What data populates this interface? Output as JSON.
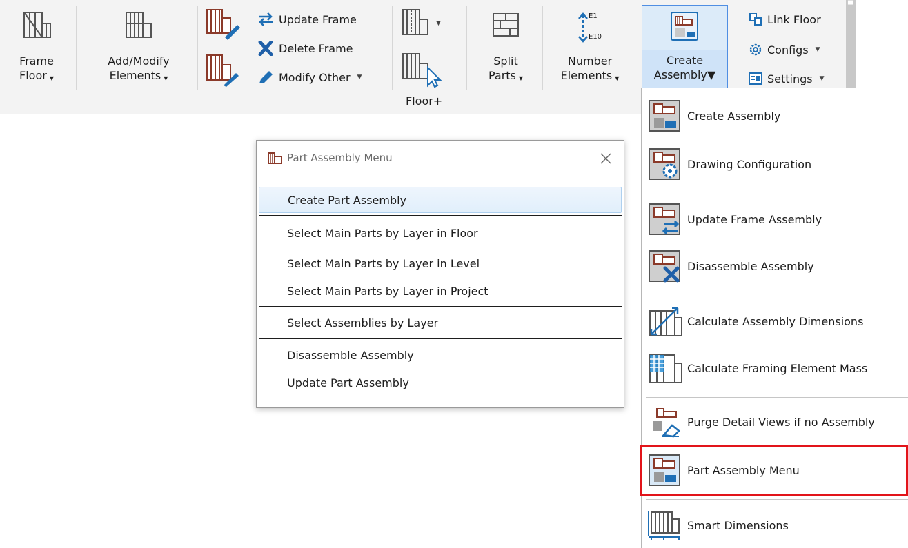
{
  "ribbon": {
    "frame_floor": [
      "Frame",
      "Floor"
    ],
    "add_modify": [
      "Add/Modify",
      "Elements"
    ],
    "update_frame": "Update Frame",
    "delete_frame": "Delete Frame",
    "modify_other": "Modify Other",
    "floor_plus_group": "Floor+",
    "split_parts": [
      "Split",
      "Parts"
    ],
    "number_elements": [
      "Number",
      "Elements"
    ],
    "number_icon_top": "E1",
    "number_icon_bottom": "E10",
    "create_assembly": [
      "Create",
      "Assembly"
    ],
    "link_floor": "Link Floor",
    "configs": "Configs",
    "settings": "Settings"
  },
  "dropdown": {
    "items": [
      "Create  Assembly",
      "Drawing Configuration",
      "Update Frame Assembly",
      "Disassemble Assembly",
      "Calculate Assembly Dimensions",
      "Calculate Framing Element Mass",
      "Purge Detail Views if no Assembly",
      "Part Assembly Menu",
      "Smart Dimensions"
    ]
  },
  "dialog": {
    "title": "Part Assembly Menu",
    "items": [
      "Create Part Assembly",
      "Select Main Parts by Layer in Floor",
      "Select Main Parts by Layer in Level",
      "Select Main Parts by Layer in Project",
      "Select Assemblies by Layer",
      "Disassemble Assembly",
      "Update Part Assembly"
    ]
  },
  "colors": {
    "icon_brown": "#8b3a2a",
    "icon_blue": "#1f6fb5",
    "highlight_red": "#e2141a",
    "selected_blue": "#dcebf9"
  }
}
